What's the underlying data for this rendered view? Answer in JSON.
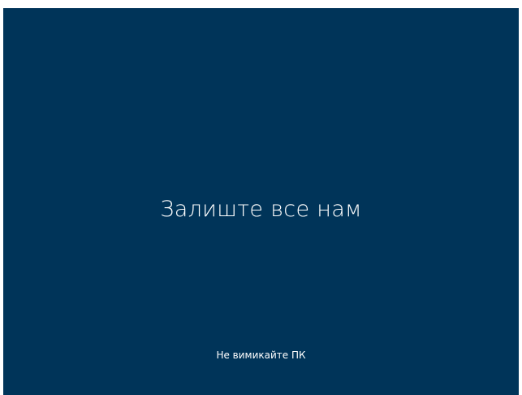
{
  "screen": {
    "background_color": "#003459",
    "text_color": "#ffffff",
    "headline": "Залиште все нам",
    "subline": "Не вимикайте ПК"
  }
}
